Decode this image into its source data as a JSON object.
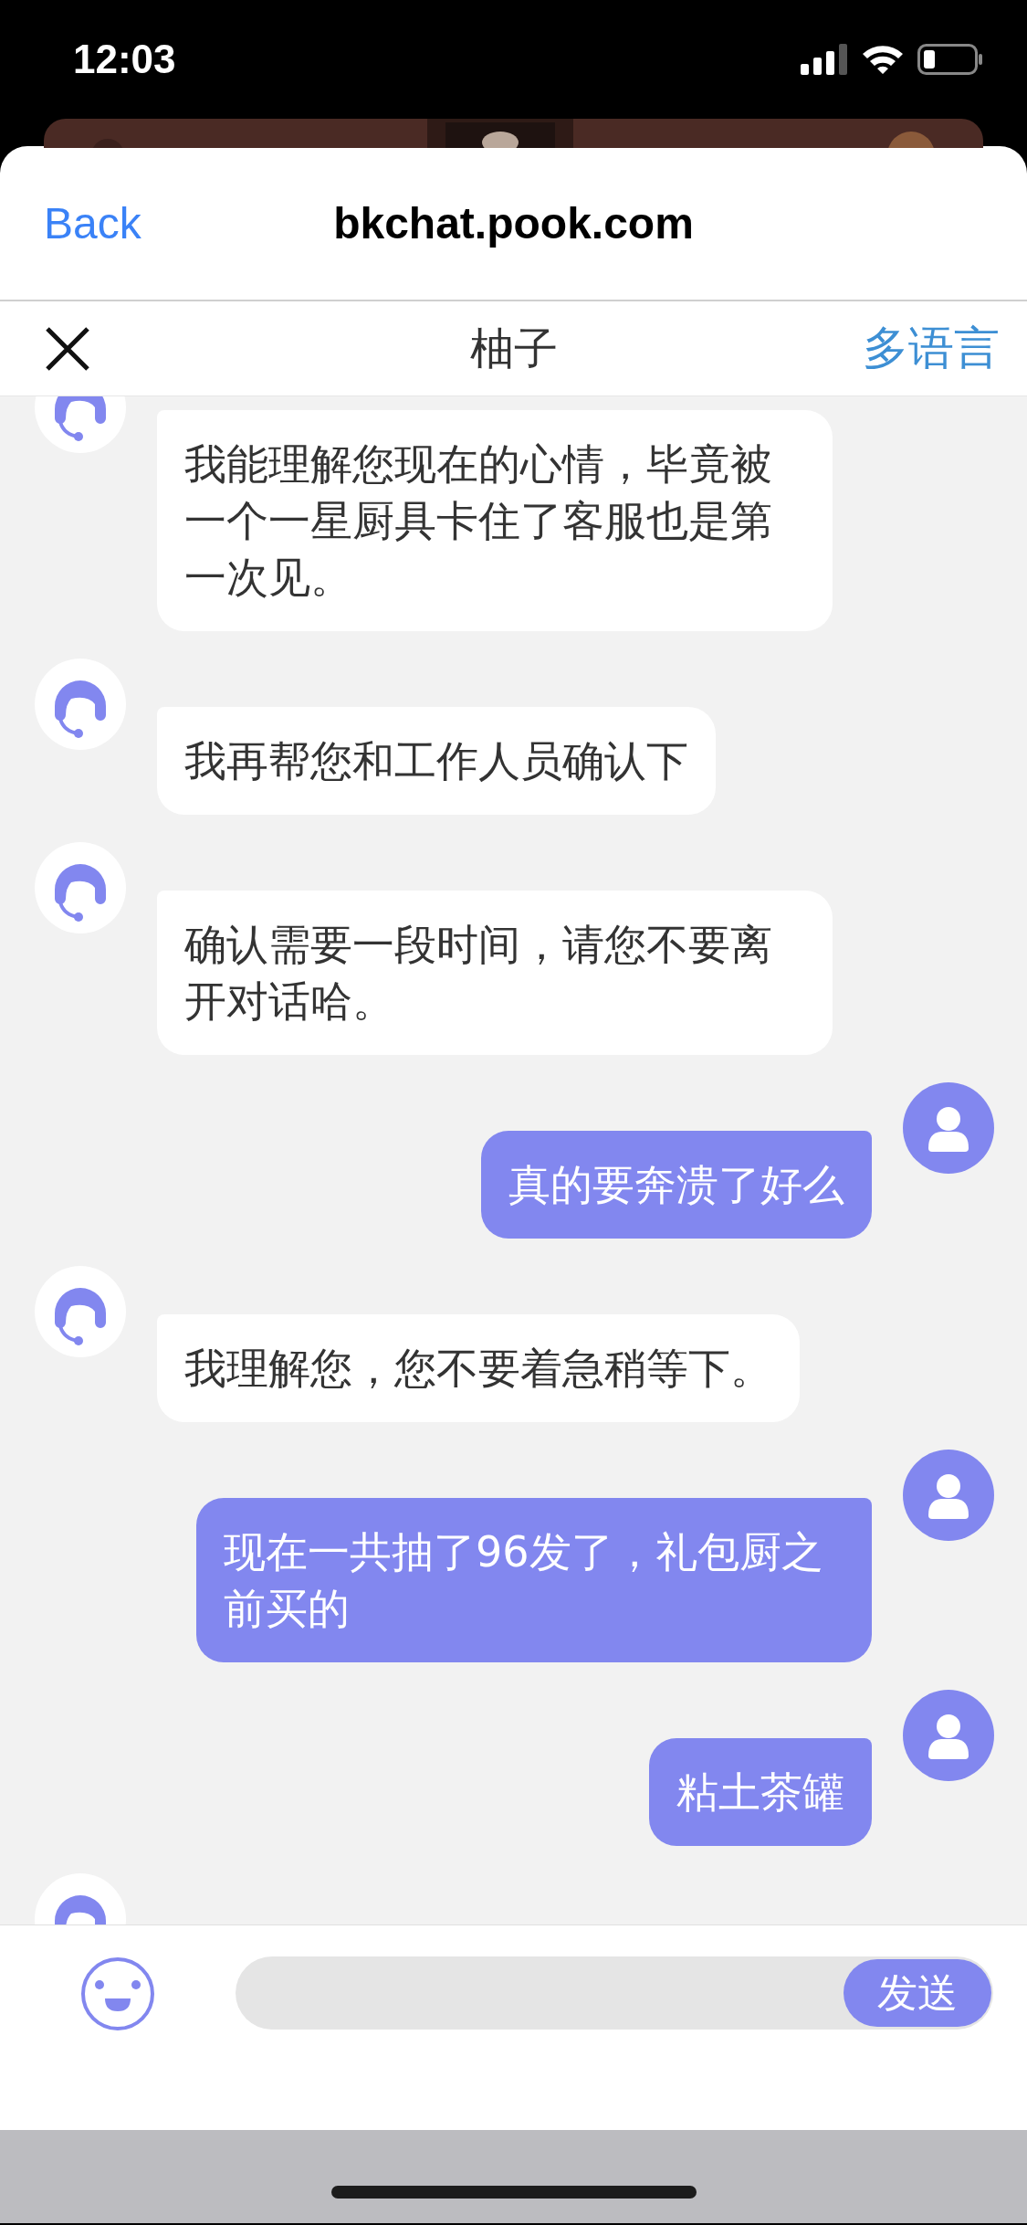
{
  "status_bar": {
    "time": "12:03"
  },
  "browser_bar": {
    "back": "Back",
    "title": "bkchat.pook.com"
  },
  "chat_header": {
    "title": "柚子",
    "language_link": "多语言"
  },
  "messages": [
    {
      "kind": "agent",
      "text": "我能理解您现在的心情，毕竟被一个一星厨具卡住了客服也是第一次见。"
    },
    {
      "kind": "agent",
      "text": "我再帮您和工作人员确认下"
    },
    {
      "kind": "agent",
      "text": "确认需要一段时间，请您不要离开对话哈。"
    },
    {
      "kind": "user",
      "text": "真的要奔溃了好么"
    },
    {
      "kind": "agent",
      "text": "我理解您，您不要着急稍等下。"
    },
    {
      "kind": "user",
      "text": "现在一共抽了96发了，礼包厨之前买的"
    },
    {
      "kind": "user",
      "text": "粘土茶罐"
    }
  ],
  "composer": {
    "send_button": "发送"
  }
}
